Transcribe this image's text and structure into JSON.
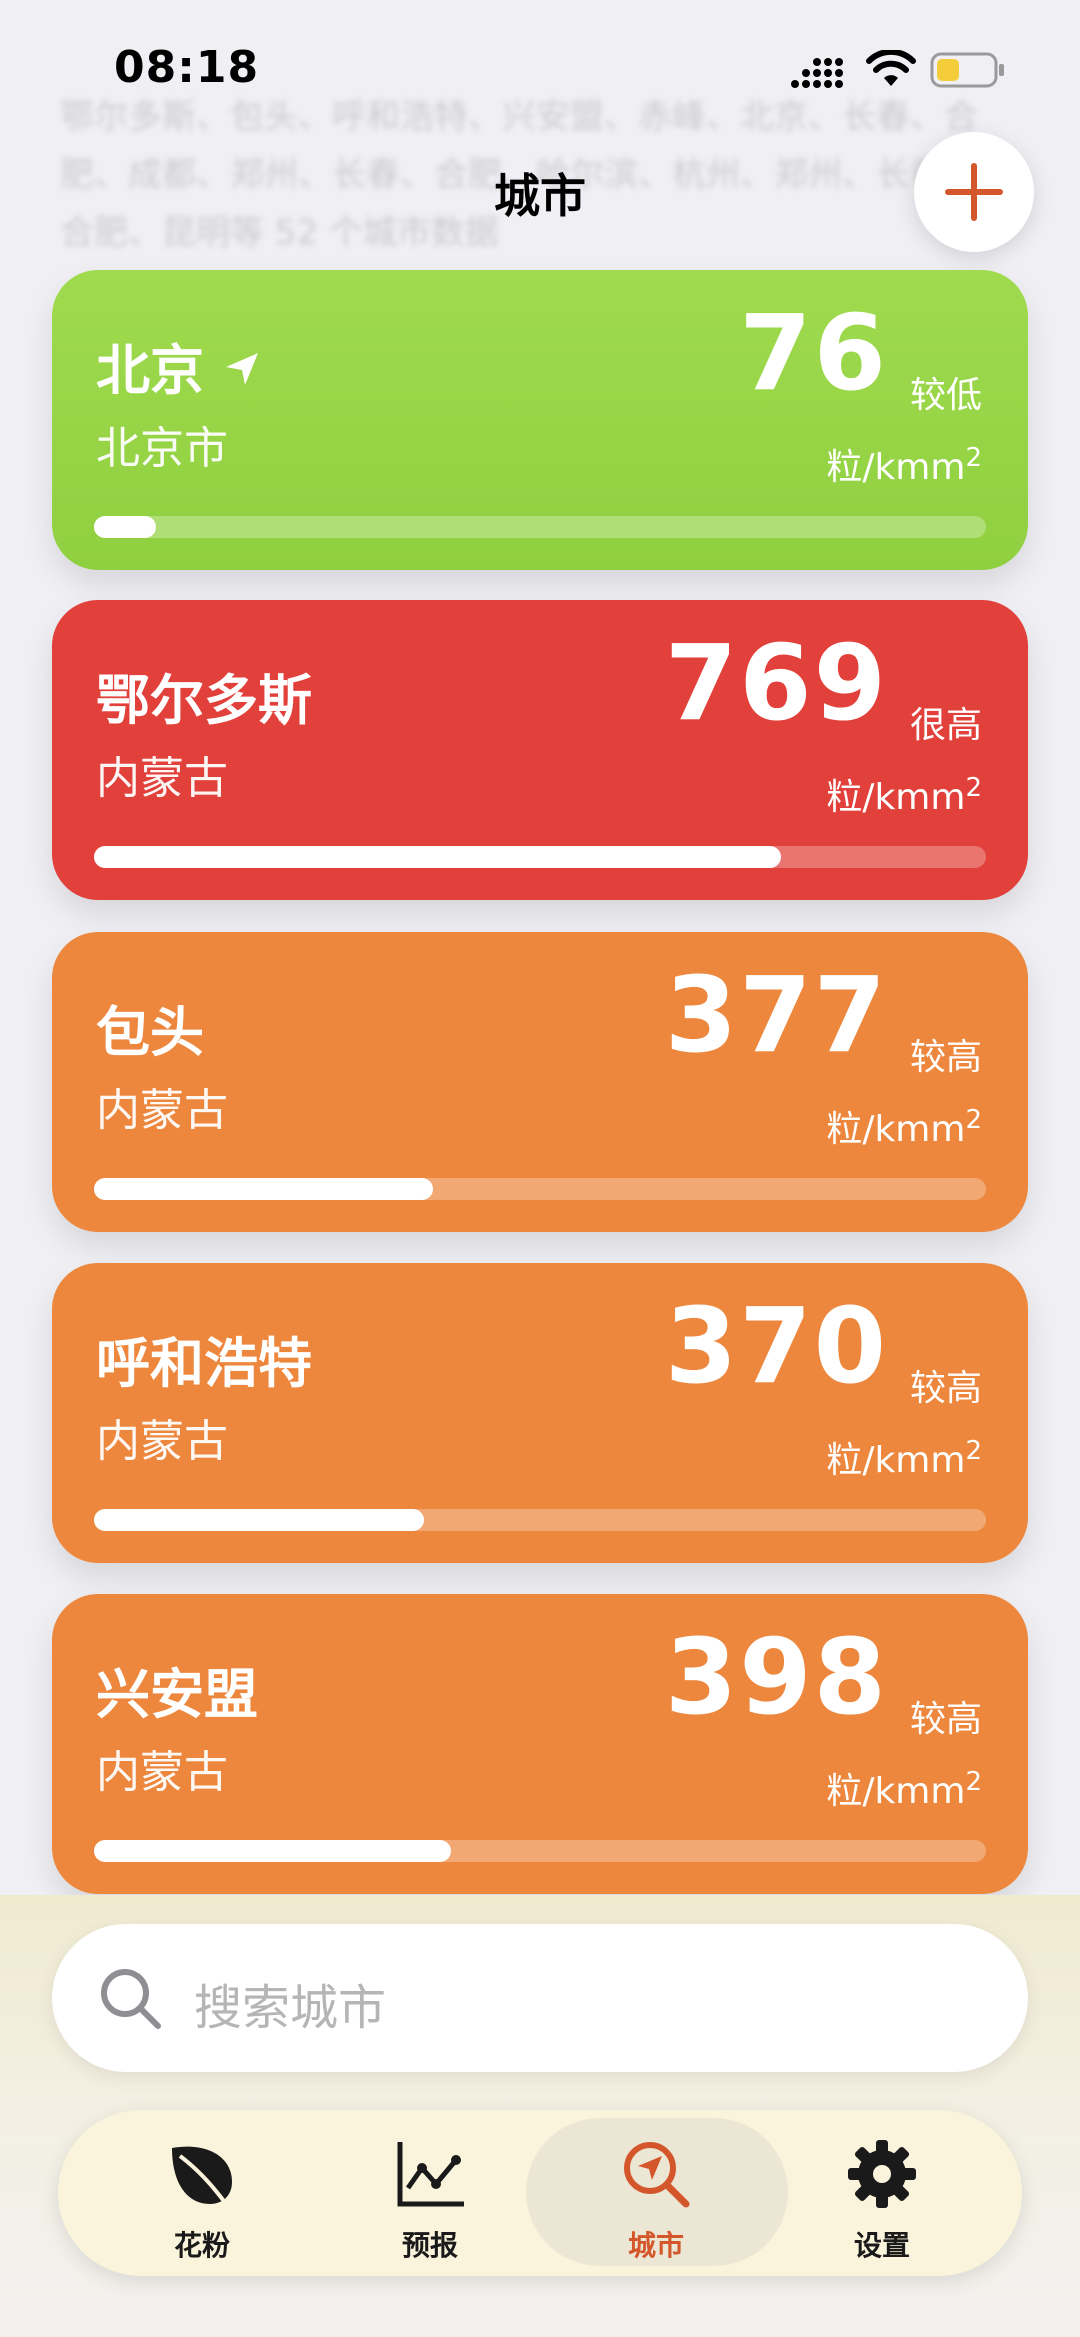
{
  "status_bar": {
    "time": "08:18"
  },
  "header": {
    "title": "城市",
    "background_text": "鄂尔多斯、包头、呼和浩特、兴安盟、赤峰、北京、长春、合肥、成都、郑州、长春、合肥、哈尔滨、杭州、郑州、长春、合肥、昆明等 52 个城市数据"
  },
  "cities": [
    {
      "name": "北京",
      "region": "北京市",
      "value": "76",
      "level": "较低",
      "unit": "粒/kmm",
      "unit_sup": "2",
      "color": "#9bd447",
      "located": true,
      "fill": 0.07
    },
    {
      "name": "鄂尔多斯",
      "region": "内蒙古",
      "value": "769",
      "level": "很高",
      "unit": "粒/kmm",
      "unit_sup": "2",
      "color": "#e2403a",
      "located": false,
      "fill": 0.77
    },
    {
      "name": "包头",
      "region": "内蒙古",
      "value": "377",
      "level": "较高",
      "unit": "粒/kmm",
      "unit_sup": "2",
      "color": "#ed873d",
      "located": false,
      "fill": 0.38
    },
    {
      "name": "呼和浩特",
      "region": "内蒙古",
      "value": "370",
      "level": "较高",
      "unit": "粒/kmm",
      "unit_sup": "2",
      "color": "#ed873d",
      "located": false,
      "fill": 0.37
    },
    {
      "name": "兴安盟",
      "region": "内蒙古",
      "value": "398",
      "level": "较高",
      "unit": "粒/kmm",
      "unit_sup": "2",
      "color": "#ed873d",
      "located": false,
      "fill": 0.4
    }
  ],
  "search": {
    "placeholder": "搜索城市"
  },
  "tabs": [
    {
      "label": "花粉",
      "icon": "leaf-icon"
    },
    {
      "label": "预报",
      "icon": "chart-line-icon"
    },
    {
      "label": "城市",
      "icon": "location-search-icon",
      "active": true
    },
    {
      "label": "设置",
      "icon": "gear-icon"
    }
  ],
  "colors": {
    "accent": "#d4572b",
    "green": "#9bd447",
    "red": "#e2403a",
    "orange": "#ed873d"
  }
}
